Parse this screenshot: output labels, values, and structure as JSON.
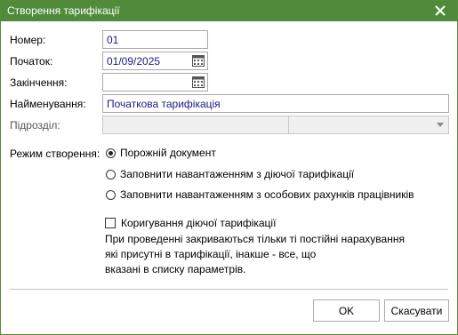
{
  "window": {
    "title": "Створення тарифікації"
  },
  "form": {
    "number_label": "Номер:",
    "number_value": "01",
    "start_label": "Початок:",
    "start_value": "01/09/2025",
    "end_label": "Закінчення:",
    "end_value": "",
    "name_label": "Найменування:",
    "name_value": "Початкова тарифікація",
    "division_label": "Підрозділ:",
    "division_value": ""
  },
  "mode": {
    "label": "Режим створення:",
    "options": [
      {
        "label": "Порожній документ",
        "selected": true
      },
      {
        "label": "Заповнити навантаженням з діючої тарифікації",
        "selected": false
      },
      {
        "label": "Заповнити навантаженням з особових рахунків працівників",
        "selected": false
      }
    ]
  },
  "adjust": {
    "label": "Коригування діючої тарифікації",
    "checked": false,
    "note_lines": [
      "При проведенні закриваються тільки ті постійні нарахування",
      "які присутні в тарифікації, інакше - все, що",
      "вказані в списку параметрів."
    ]
  },
  "buttons": {
    "ok": "OK",
    "cancel": "Скасувати"
  },
  "colors": {
    "titlebar": "#4f8b3a",
    "field_text": "#1a1a80"
  },
  "icons": {
    "close": "close-icon",
    "calendar": "calendar-icon",
    "dropdown": "chevron-down-icon"
  }
}
